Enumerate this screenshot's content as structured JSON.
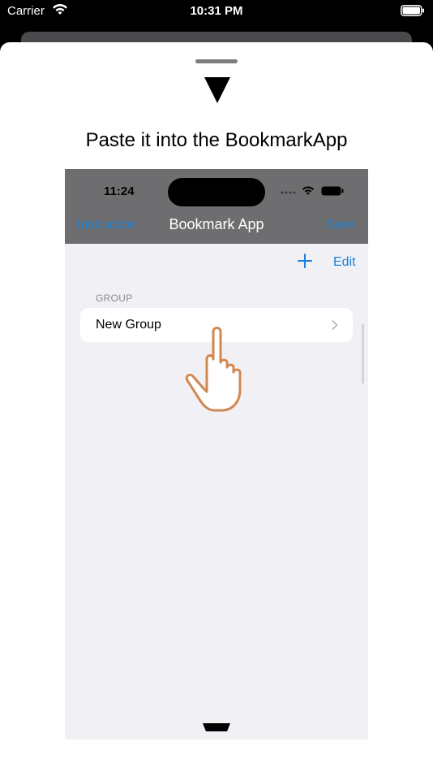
{
  "status_bar": {
    "carrier": "Carrier",
    "time": "10:31 PM"
  },
  "sheet": {
    "instruction": "Paste it into the BookmarkApp"
  },
  "phone": {
    "time": "11:24",
    "nav": {
      "left": "Instruction",
      "title": "Bookmark App",
      "right": "Save"
    },
    "edit_label": "Edit",
    "section_header": "GROUP",
    "rows": [
      {
        "label": "New Group"
      }
    ]
  },
  "colors": {
    "accent": "#1a7fd9",
    "hand": "#d2874f"
  }
}
